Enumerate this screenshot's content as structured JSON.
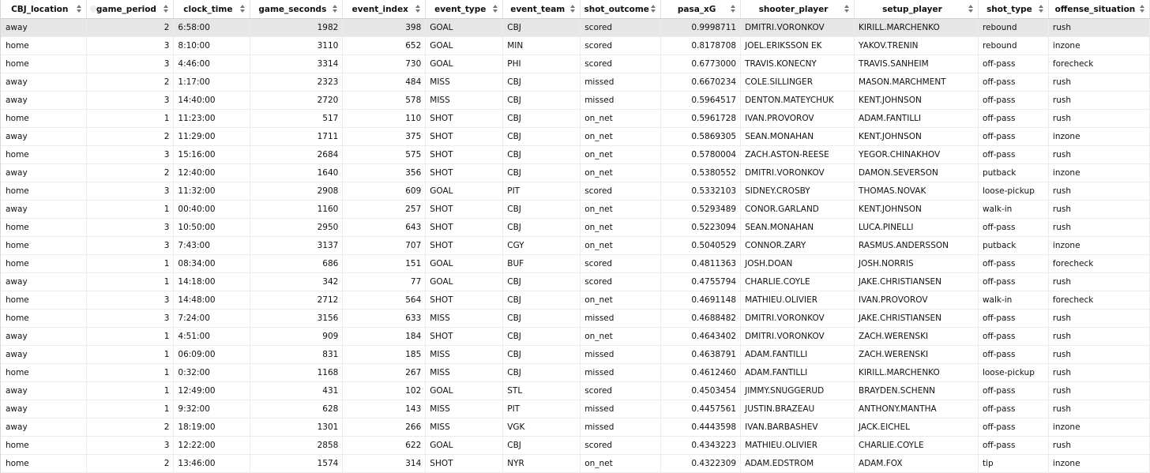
{
  "columns": [
    "CBJ_location",
    "game_period",
    "clock_time",
    "game_seconds",
    "event_index",
    "event_type",
    "event_team",
    "shot_outcome",
    "pasa_xG",
    "shooter_player",
    "setup_player",
    "shot_type",
    "offense_situation"
  ],
  "numeric_columns": [
    1,
    3,
    4,
    8
  ],
  "rows": [
    [
      "away",
      "2",
      "6:58:00",
      "1982",
      "398",
      "GOAL",
      "CBJ",
      "scored",
      "0.9998711",
      "DMITRI.VORONKOV",
      "KIRILL.MARCHENKO",
      "rebound",
      "rush"
    ],
    [
      "home",
      "3",
      "8:10:00",
      "3110",
      "652",
      "GOAL",
      "MIN",
      "scored",
      "0.8178708",
      "JOEL.ERIKSSON EK",
      "YAKOV.TRENIN",
      "rebound",
      "inzone"
    ],
    [
      "home",
      "3",
      "4:46:00",
      "3314",
      "730",
      "GOAL",
      "PHI",
      "scored",
      "0.6773000",
      "TRAVIS.KONECNY",
      "TRAVIS.SANHEIM",
      "off-pass",
      "forecheck"
    ],
    [
      "away",
      "2",
      "1:17:00",
      "2323",
      "484",
      "MISS",
      "CBJ",
      "missed",
      "0.6670234",
      "COLE.SILLINGER",
      "MASON.MARCHMENT",
      "off-pass",
      "rush"
    ],
    [
      "away",
      "3",
      "14:40:00",
      "2720",
      "578",
      "MISS",
      "CBJ",
      "missed",
      "0.5964517",
      "DENTON.MATEYCHUK",
      "KENT.JOHNSON",
      "off-pass",
      "rush"
    ],
    [
      "home",
      "1",
      "11:23:00",
      "517",
      "110",
      "SHOT",
      "CBJ",
      "on_net",
      "0.5961728",
      "IVAN.PROVOROV",
      "ADAM.FANTILLI",
      "off-pass",
      "rush"
    ],
    [
      "away",
      "2",
      "11:29:00",
      "1711",
      "375",
      "SHOT",
      "CBJ",
      "on_net",
      "0.5869305",
      "SEAN.MONAHAN",
      "KENT.JOHNSON",
      "off-pass",
      "inzone"
    ],
    [
      "home",
      "3",
      "15:16:00",
      "2684",
      "575",
      "SHOT",
      "CBJ",
      "on_net",
      "0.5780004",
      "ZACH.ASTON-REESE",
      "YEGOR.CHINAKHOV",
      "off-pass",
      "rush"
    ],
    [
      "away",
      "2",
      "12:40:00",
      "1640",
      "356",
      "SHOT",
      "CBJ",
      "on_net",
      "0.5380552",
      "DMITRI.VORONKOV",
      "DAMON.SEVERSON",
      "putback",
      "inzone"
    ],
    [
      "home",
      "3",
      "11:32:00",
      "2908",
      "609",
      "GOAL",
      "PIT",
      "scored",
      "0.5332103",
      "SIDNEY.CROSBY",
      "THOMAS.NOVAK",
      "loose-pickup",
      "rush"
    ],
    [
      "away",
      "1",
      "00:40:00",
      "1160",
      "257",
      "SHOT",
      "CBJ",
      "on_net",
      "0.5293489",
      "CONOR.GARLAND",
      "KENT.JOHNSON",
      "walk-in",
      "rush"
    ],
    [
      "home",
      "3",
      "10:50:00",
      "2950",
      "643",
      "SHOT",
      "CBJ",
      "on_net",
      "0.5223094",
      "SEAN.MONAHAN",
      "LUCA.PINELLI",
      "off-pass",
      "rush"
    ],
    [
      "home",
      "3",
      "7:43:00",
      "3137",
      "707",
      "SHOT",
      "CGY",
      "on_net",
      "0.5040529",
      "CONNOR.ZARY",
      "RASMUS.ANDERSSON",
      "putback",
      "inzone"
    ],
    [
      "home",
      "1",
      "08:34:00",
      "686",
      "151",
      "GOAL",
      "BUF",
      "scored",
      "0.4811363",
      "JOSH.DOAN",
      "JOSH.NORRIS",
      "off-pass",
      "forecheck"
    ],
    [
      "away",
      "1",
      "14:18:00",
      "342",
      "77",
      "GOAL",
      "CBJ",
      "scored",
      "0.4755794",
      "CHARLIE.COYLE",
      "JAKE.CHRISTIANSEN",
      "off-pass",
      "rush"
    ],
    [
      "home",
      "3",
      "14:48:00",
      "2712",
      "564",
      "SHOT",
      "CBJ",
      "on_net",
      "0.4691148",
      "MATHIEU.OLIVIER",
      "IVAN.PROVOROV",
      "walk-in",
      "forecheck"
    ],
    [
      "home",
      "3",
      "7:24:00",
      "3156",
      "633",
      "MISS",
      "CBJ",
      "missed",
      "0.4688482",
      "DMITRI.VORONKOV",
      "JAKE.CHRISTIANSEN",
      "off-pass",
      "rush"
    ],
    [
      "away",
      "1",
      "4:51:00",
      "909",
      "184",
      "SHOT",
      "CBJ",
      "on_net",
      "0.4643402",
      "DMITRI.VORONKOV",
      "ZACH.WERENSKI",
      "off-pass",
      "rush"
    ],
    [
      "away",
      "1",
      "06:09:00",
      "831",
      "185",
      "MISS",
      "CBJ",
      "missed",
      "0.4638791",
      "ADAM.FANTILLI",
      "ZACH.WERENSKI",
      "off-pass",
      "rush"
    ],
    [
      "home",
      "1",
      "0:32:00",
      "1168",
      "267",
      "MISS",
      "CBJ",
      "missed",
      "0.4612460",
      "ADAM.FANTILLI",
      "KIRILL.MARCHENKO",
      "loose-pickup",
      "rush"
    ],
    [
      "away",
      "1",
      "12:49:00",
      "431",
      "102",
      "GOAL",
      "STL",
      "scored",
      "0.4503454",
      "JIMMY.SNUGGERUD",
      "BRAYDEN.SCHENN",
      "off-pass",
      "rush"
    ],
    [
      "away",
      "1",
      "9:32:00",
      "628",
      "143",
      "MISS",
      "PIT",
      "missed",
      "0.4457561",
      "JUSTIN.BRAZEAU",
      "ANTHONY.MANTHA",
      "off-pass",
      "rush"
    ],
    [
      "away",
      "2",
      "18:19:00",
      "1301",
      "266",
      "MISS",
      "VGK",
      "missed",
      "0.4443598",
      "IVAN.BARBASHEV",
      "JACK.EICHEL",
      "off-pass",
      "inzone"
    ],
    [
      "home",
      "3",
      "12:22:00",
      "2858",
      "622",
      "GOAL",
      "CBJ",
      "scored",
      "0.4343223",
      "MATHIEU.OLIVIER",
      "CHARLIE.COYLE",
      "off-pass",
      "rush"
    ],
    [
      "home",
      "2",
      "13:46:00",
      "1574",
      "314",
      "SHOT",
      "NYR",
      "on_net",
      "0.4322309",
      "ADAM.EDSTROM",
      "ADAM.FOX",
      "tip",
      "inzone"
    ]
  ]
}
